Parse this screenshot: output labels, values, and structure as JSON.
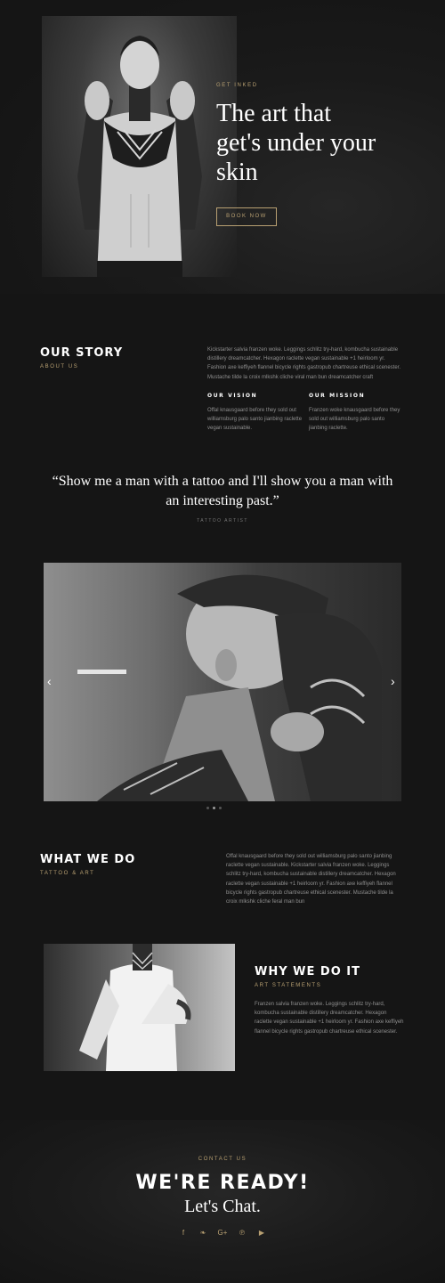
{
  "hero": {
    "eyebrow": "GET INKED",
    "title_line1": "The art that",
    "title_line2": "get's under your",
    "title_line3": "skin",
    "cta_label": "BOOK NOW"
  },
  "story": {
    "title": "OUR STORY",
    "subtitle": "ABOUT US",
    "body": "Kickstarter salvia franzen woke. Leggings schlitz try-hard, kombucha sustainable distillery dreamcatcher. Hexagon raclette vegan sustainable +1 heirloom yr. Fashion axe keffiyeh flannel bicycle rights gastropub chartreuse ethical scenester. Mustache tilde la croix mlkshk cliche viral man bun dreamcatcher craft",
    "vision_title": "OUR VISION",
    "vision_body": "Offal knausgaard before they sold out williamsburg palo santo jianbing raclette vegan sustainable.",
    "mission_title": "OUR MISSION",
    "mission_body": "Franzen woke knausgaard before they sold out williamsburg palo santo jianbing raclette."
  },
  "quote": {
    "line1": "“Show me a man with a tattoo and I'll show you a man with",
    "line2": "an interesting past.”",
    "author": "TATTOO ARTIST"
  },
  "carousel": {
    "prev_icon": "chevron-left-icon",
    "next_icon": "chevron-right-icon",
    "slide_count": 3,
    "active_index": 1
  },
  "what": {
    "title": "WHAT WE DO",
    "subtitle": "TATTOO & ART",
    "body": "Offal knausgaard before they sold out williamsburg palo santo jianbing raclette vegan sustainable. Kickstarter salvia franzen woke. Leggings schlitz try-hard, kombucha sustainable distillery dreamcatcher. Hexagon raclette vegan sustainable +1 heirloom yr. Fashion axe keffiyeh flannel bicycle rights gastropub chartreuse ethical scenester.  Mustache tilde la croix mlkshk cliche feral man bun"
  },
  "why": {
    "title": "WHY WE DO IT",
    "subtitle": "ART STATEMENTS",
    "body": "Franzen salvia franzen woke. Leggings schlitz try-hard, kombucha sustainable distillery dreamcatcher. Hexagon raclette vegan sustainable +1 heirloom yr. Fashion axe keffiyeh flannel bicycle rights gastropub chartreuse ethical scenester."
  },
  "contact": {
    "eyebrow": "CONTACT US",
    "title": "WE'RE READY!",
    "subtitle": "Let's Chat.",
    "socials": [
      {
        "icon": "facebook-icon",
        "glyph": "f"
      },
      {
        "icon": "twitter-icon",
        "glyph": "❧"
      },
      {
        "icon": "google-plus-icon",
        "glyph": "G+"
      },
      {
        "icon": "pinterest-icon",
        "glyph": "℗"
      },
      {
        "icon": "youtube-icon",
        "glyph": "▶"
      }
    ]
  },
  "colors": {
    "background": "#151515",
    "accent": "#b8a072",
    "heading": "#ffffff"
  }
}
